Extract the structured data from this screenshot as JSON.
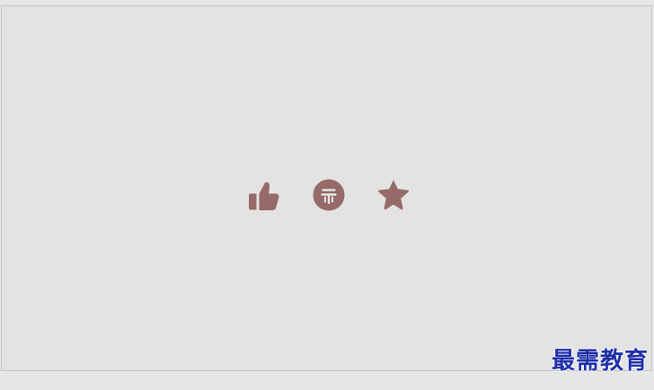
{
  "colors": {
    "icon": "#956a68",
    "icon_inner": "#e6e6e6",
    "canvas": "#e3e3e3",
    "watermark": "#1f2fa8"
  },
  "actions": [
    {
      "icon": "thumbs-up-icon"
    },
    {
      "icon": "coin-icon"
    },
    {
      "icon": "star-icon"
    }
  ],
  "watermark": {
    "text": "最需教育"
  }
}
